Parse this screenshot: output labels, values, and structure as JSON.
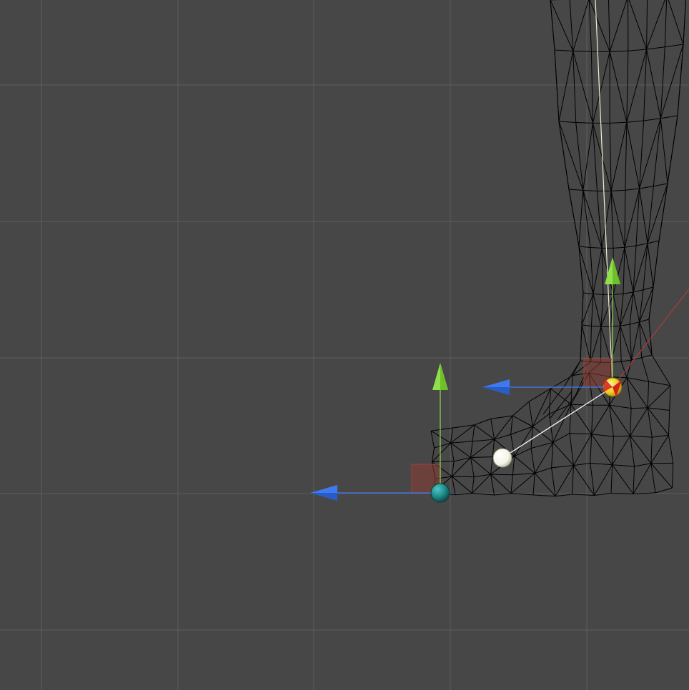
{
  "scene_view": {
    "background_color": "#474747",
    "grid_color": "#5c5c5c",
    "grid_enabled": true,
    "mesh_color": "#000000",
    "mesh_render_mode": "wireframe"
  },
  "gizmos": {
    "y_axis_color": "#8fe04a",
    "z_axis_color": "#3f79f0",
    "x_axis_color": "#c23a3a",
    "ankle_handle": {
      "icon": "yellow-red-sphere-icon",
      "colors": [
        "#f0d020",
        "#d42020"
      ]
    },
    "toe_handle": {
      "icon": "teal-sphere-icon",
      "color": "#1f8a8a"
    },
    "heel_handle": {
      "icon": "white-sphere-icon",
      "color": "#f4f4e8"
    },
    "bone_line_color": "#f0f0d0",
    "plane_handle_color": "#8a3a32"
  }
}
